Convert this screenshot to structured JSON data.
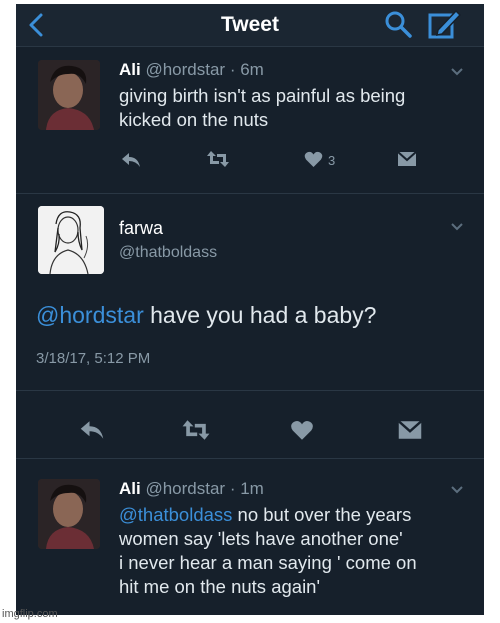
{
  "header": {
    "title": "Tweet"
  },
  "tweet1": {
    "name": "Ali",
    "handle": "@hordstar · 6m",
    "text_line1": "giving birth isn't as painful as being",
    "text_line2": "kicked on the nuts",
    "like_count": "3"
  },
  "tweet2": {
    "name": "farwa",
    "handle": "@thatboldass",
    "mention": "@hordstar",
    "text": " have you had a baby?",
    "timestamp": "3/18/17, 5:12 PM"
  },
  "tweet3": {
    "name": "Ali",
    "handle": "@hordstar · 1m",
    "mention": "@thatboldass",
    "text_line1": " no but over the years",
    "text_line2": "women say 'lets have another one'",
    "text_line3": "i never hear a man saying ' come on",
    "text_line4": "hit me on the nuts again'"
  },
  "watermark": "imgflip.com",
  "colors": {
    "background": "#16202b",
    "accent": "#3b8fd9",
    "muted": "#8899a6"
  },
  "icons": [
    "back-chevron-icon",
    "search-icon",
    "compose-icon",
    "reply-icon",
    "retweet-icon",
    "heart-icon",
    "direct-message-icon",
    "caret-down-icon"
  ]
}
